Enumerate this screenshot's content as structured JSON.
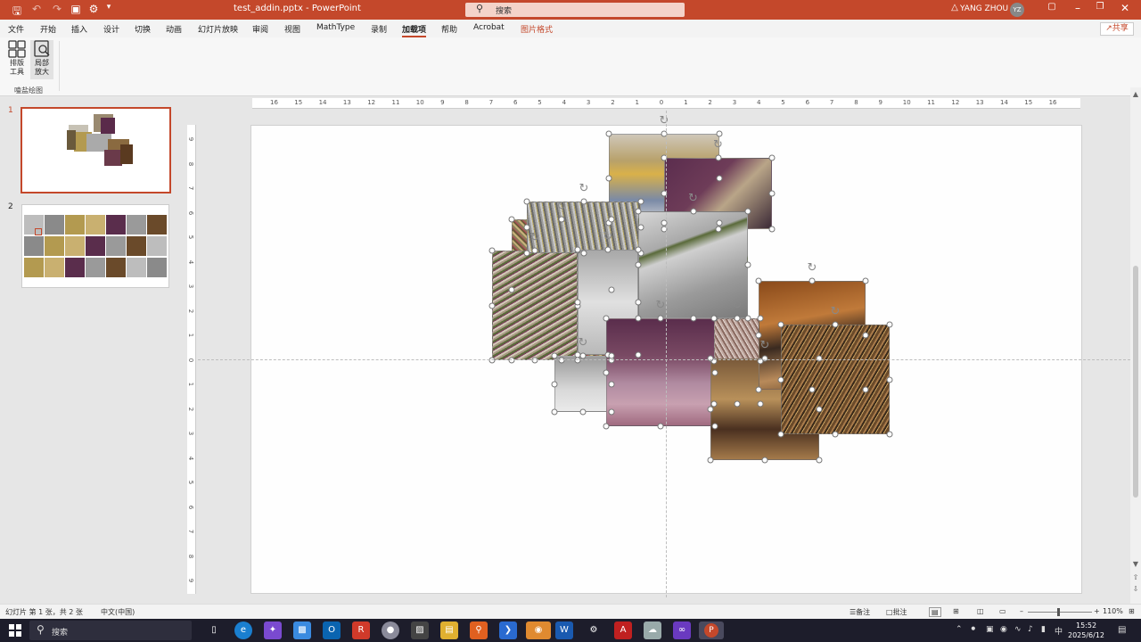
{
  "titlebar": {
    "filename": "test_addin.pptx",
    "separator": "-",
    "app": "PowerPoint",
    "search_placeholder": "搜索",
    "user_name": "YANG ZHOU",
    "avatar_initials": "YZ",
    "accent_color": "#c4482b",
    "qat_icons": [
      "save-icon",
      "undo-icon",
      "redo-icon",
      "present-icon",
      "touch-mode-icon",
      "customize-icon"
    ],
    "window_controls": [
      "minimize-icon",
      "restore-icon",
      "close-icon"
    ]
  },
  "menubar": {
    "items": [
      "文件",
      "开始",
      "插入",
      "设计",
      "切换",
      "动画",
      "幻灯片放映",
      "审阅",
      "视图",
      "MathType",
      "录制",
      "加载项",
      "帮助",
      "Acrobat",
      "图片格式"
    ],
    "active": "加载项",
    "share_label": "共享"
  },
  "ribbon": {
    "buttons": [
      {
        "label1": "排版",
        "label2": "工具",
        "icon": "layout-grid-icon"
      },
      {
        "label1": "局部",
        "label2": "放大",
        "icon": "zoom-region-icon"
      }
    ],
    "group_label": "嗑盐绘图"
  },
  "slides_panel": {
    "slide_numbers": [
      "1",
      "2"
    ],
    "selected": "1"
  },
  "rulers": {
    "horizontal": [
      "16",
      "15",
      "14",
      "13",
      "12",
      "11",
      "10",
      "9",
      "8",
      "7",
      "6",
      "5",
      "4",
      "3",
      "2",
      "1",
      "0",
      "1",
      "2",
      "3",
      "4",
      "5",
      "6",
      "7",
      "8",
      "9",
      "10",
      "11",
      "12",
      "13",
      "14",
      "15",
      "16"
    ],
    "vertical": [
      "9",
      "8",
      "7",
      "6",
      "5",
      "4",
      "3",
      "2",
      "1",
      "0",
      "1",
      "2",
      "3",
      "4",
      "5",
      "6",
      "7",
      "8",
      "9"
    ]
  },
  "statusbar": {
    "slide_info": "幻灯片 第 1 张，共 2 张",
    "language": "中文(中国)",
    "notes_label": "备注",
    "comments_label": "批注",
    "zoom": "110%"
  },
  "taskbar": {
    "search_placeholder": "搜索",
    "apps": [
      "task-view-icon",
      "edge-icon",
      "copilot-icon",
      "store-icon",
      "outlook-icon",
      "app-red-icon",
      "app-circle-icon",
      "terminal-icon",
      "file-explorer-icon",
      "search-app-icon",
      "vscode-blue-icon",
      "wechat-icon",
      "word-icon",
      "settings-icon",
      "acrobat-icon",
      "app-cloud-icon",
      "visual-studio-icon",
      "powerpoint-icon"
    ],
    "ime": "中",
    "time": "15:52",
    "date": "2025/6/12"
  }
}
